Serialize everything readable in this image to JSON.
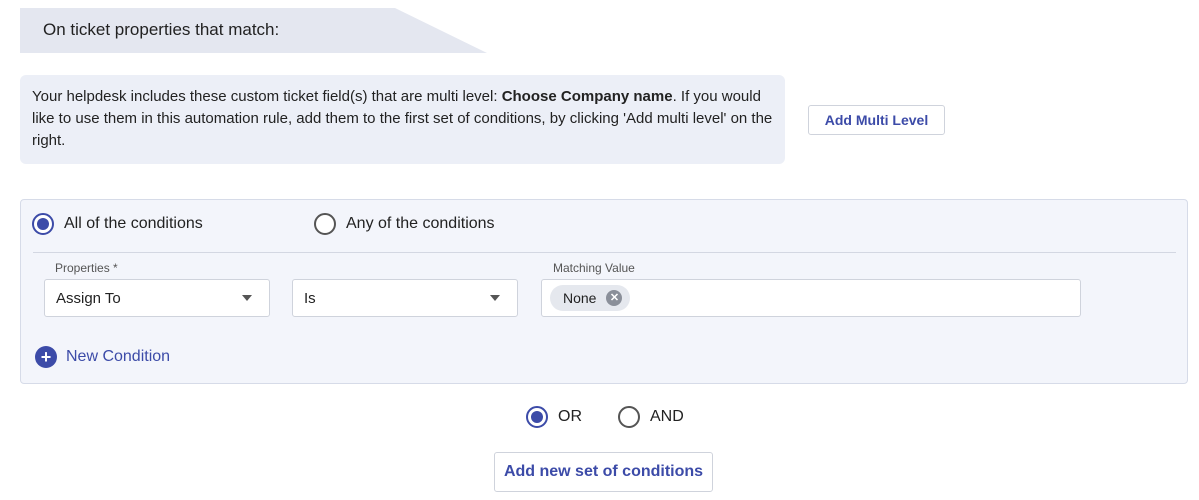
{
  "section": {
    "title": "On ticket properties that match:"
  },
  "info": {
    "text_before": "Your helpdesk includes these custom ticket field(s) that are multi level: ",
    "field_name": "Choose Company name",
    "text_after": ". If you would like to use them in this automation rule, add them to the first set of conditions, by clicking 'Add multi level' on the right."
  },
  "add_multi_level_label": "Add Multi Level",
  "match_mode": {
    "options": [
      {
        "label": "All of the conditions",
        "checked": true
      },
      {
        "label": "Any of the conditions",
        "checked": false
      }
    ]
  },
  "condition": {
    "properties_label": "Properties *",
    "property_value": "Assign To",
    "operator_value": "Is",
    "matching_label": "Matching Value",
    "matching_chip": "None",
    "chip_remove_glyph": "✕"
  },
  "new_condition": {
    "icon_glyph": "+",
    "label": "New Condition"
  },
  "join_mode": {
    "options": [
      {
        "label": "OR",
        "checked": true
      },
      {
        "label": "AND",
        "checked": false
      }
    ]
  },
  "add_set_label": "Add new set of conditions",
  "colors": {
    "accent": "#3c4ba8",
    "header_bg": "#e4e7f0",
    "panel_bg": "#f3f5fb",
    "info_bg": "#eceff7"
  },
  "icons": {
    "caret": "chevron-down-icon",
    "chip_remove": "close-icon",
    "add": "plus-icon"
  }
}
